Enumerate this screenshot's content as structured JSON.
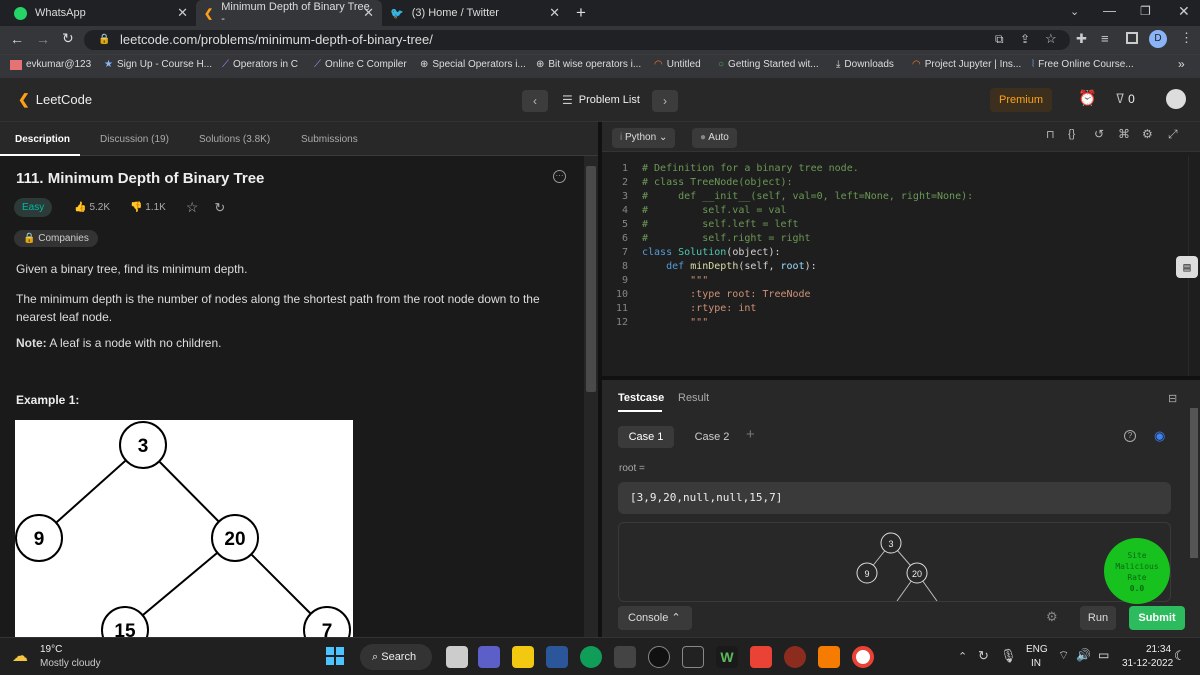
{
  "browser": {
    "tabs": [
      {
        "title": "WhatsApp"
      },
      {
        "title": "Minimum Depth of Binary Tree -"
      },
      {
        "title": "(3) Home / Twitter"
      }
    ],
    "url": "leetcode.com/problems/minimum-depth-of-binary-tree/",
    "profile_initial": "D",
    "bookmarks": [
      "evkumar@123",
      "Sign Up - Course H...",
      "Operators in C",
      "Online C Compiler",
      "Special Operators i...",
      "Bit wise operators i...",
      "Untitled",
      "Getting Started wit...",
      "Downloads",
      "Project Jupyter | Ins...",
      "Free Online Course..."
    ],
    "bookmarks_more": "»"
  },
  "leetcode": {
    "logo": "LeetCode",
    "problem_list": "Problem List",
    "premium": "Premium",
    "streak": "0",
    "panel_tabs": [
      "Description",
      "Discussion (19)",
      "Solutions (3.8K)",
      "Submissions"
    ],
    "language": "Python",
    "auto": "Auto"
  },
  "problem": {
    "title": "111. Minimum Depth of Binary Tree",
    "difficulty": "Easy",
    "likes": "5.2K",
    "dislikes": "1.1K",
    "companies": "Companies",
    "p1": "Given a binary tree, find its minimum depth.",
    "p2": "The minimum depth is the number of nodes along the shortest path from the root node down to the nearest leaf node.",
    "note_label": "Note:",
    "note_text": " A leaf is a node with no children.",
    "example_title": "Example 1:",
    "tree_nodes": [
      "3",
      "9",
      "20",
      "15",
      "7"
    ]
  },
  "code_lines": [
    "1",
    "2",
    "3",
    "4",
    "5",
    "6",
    "7",
    "8",
    "9",
    "10",
    "11",
    "12"
  ],
  "code": {
    "l1": "# Definition for a binary tree node.",
    "l2": "# class TreeNode(object):",
    "l3": "#     def __init__(self, val=0, left=None, right=None):",
    "l4": "#         self.val = val",
    "l5": "#         self.left = left",
    "l6": "#         self.right = right",
    "l7a": "class ",
    "l7b": "Solution",
    "l7c": "(object):",
    "l8a": "    ",
    "l8b": "def ",
    "l8c": "minDepth",
    "l8d": "(self, ",
    "l8e": "root",
    "l8f": "):",
    "l9": "        \"\"\"",
    "l10": "        :type root: TreeNode",
    "l11": "        :rtype: int",
    "l12": "        \"\"\""
  },
  "testcase": {
    "tab_testcase": "Testcase",
    "tab_result": "Result",
    "case1": "Case 1",
    "case2": "Case 2",
    "add": "+",
    "root_label": "root =",
    "root_value": "[3,9,20,null,null,15,7]",
    "preview_nodes": [
      "3",
      "9",
      "20"
    ],
    "badge_line1": "Site",
    "badge_line2": "Malicious",
    "badge_line3": "Rate",
    "badge_line4": "0.0",
    "console": "Console",
    "run": "Run",
    "submit": "Submit"
  },
  "taskbar": {
    "temp": "19°C",
    "weather": "Mostly cloudy",
    "search": "Search",
    "lang1": "ENG",
    "lang2": "IN",
    "time": "21:34",
    "date": "31-12-2022"
  },
  "colors": {
    "easy": "#00b8a3",
    "premium": "#ffa116",
    "submit": "#2cbb5d",
    "badge": "#17c21f"
  }
}
